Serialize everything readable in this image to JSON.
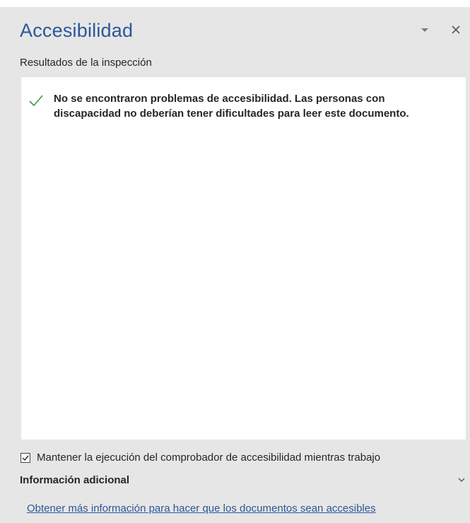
{
  "pane": {
    "title": "Accesibilidad",
    "subtitle": "Resultados de la inspección"
  },
  "results": {
    "message": "No se encontraron problemas de accesibilidad. Las personas con discapacidad no deberían tener dificultades para leer este documento."
  },
  "options": {
    "keep_running_label": "Mantener la ejecución del comprobador de accesibilidad mientras trabajo",
    "keep_running_checked": true
  },
  "more_info": {
    "label": "Información adicional",
    "link_text": "Obtener más información para hacer que los documentos sean accesibles"
  },
  "colors": {
    "title": "#2b579a",
    "check": "#3a9a3a",
    "link": "#2b579a"
  },
  "icons": [
    "chevron-down-icon",
    "close-icon",
    "checkmark-icon",
    "checkbox-checked-icon",
    "chevron-down-icon"
  ]
}
